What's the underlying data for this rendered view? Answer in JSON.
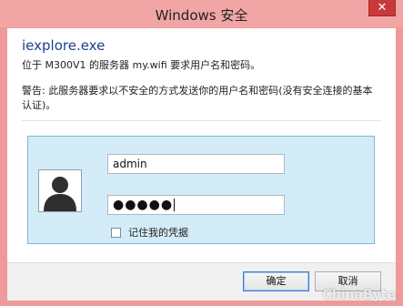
{
  "window": {
    "title": "Windows 安全",
    "close_glyph": "✕"
  },
  "dialog": {
    "app_name": "iexplore.exe",
    "message": "位于 M300V1 的服务器 my.wifi 要求用户名和密码。",
    "warning": "警告: 此服务器要求以不安全的方式发送你的用户名和密码(没有安全连接的基本认证)。"
  },
  "credentials": {
    "username_value": "admin",
    "password_value": "●●●●●",
    "remember_label": "记住我的凭据",
    "remember_checked": false
  },
  "buttons": {
    "ok_label": "确定",
    "cancel_label": "取消"
  },
  "watermark": {
    "text": "ChinaByte"
  },
  "icons": {
    "avatar": "user-avatar-icon",
    "close": "close-icon"
  },
  "colors": {
    "title_bar": "#f2a5a5",
    "panel_bg": "#d3ecf7",
    "app_name": "#1e3f8f",
    "close_button": "#c7393a"
  }
}
